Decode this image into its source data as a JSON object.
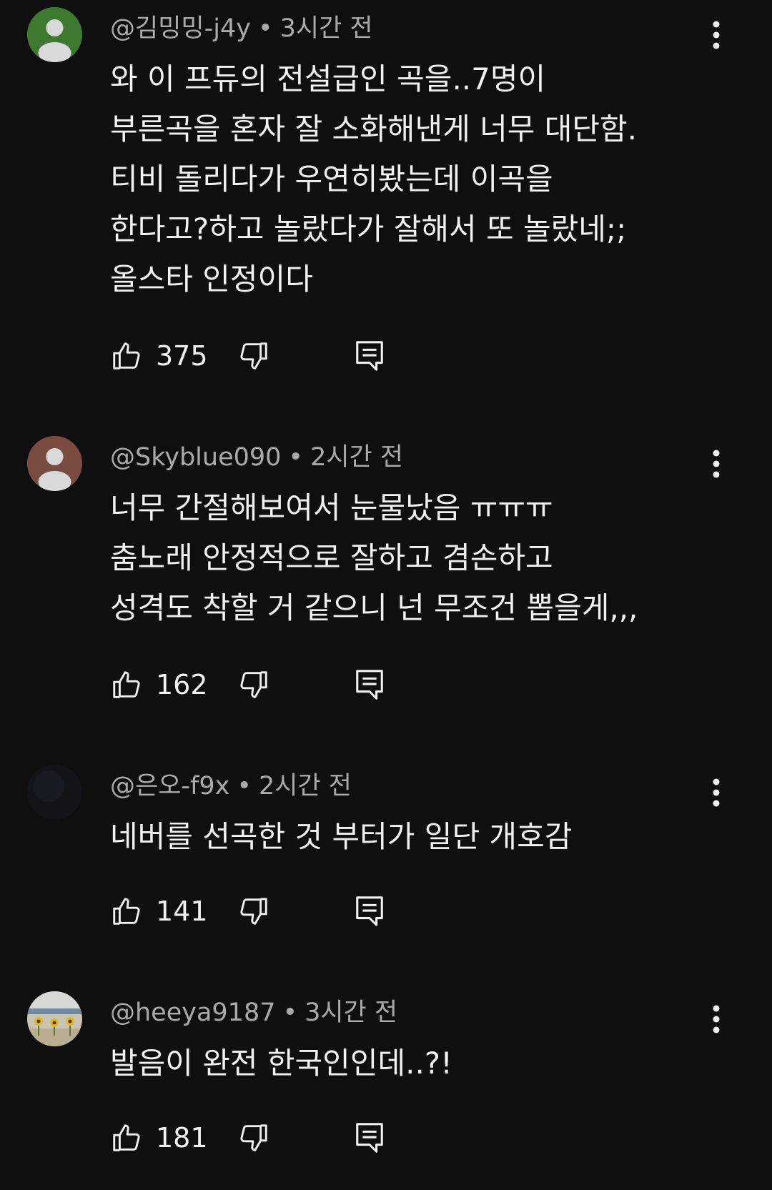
{
  "comments": [
    {
      "author": "@김밍밍-j4y",
      "time": "3시간 전",
      "avatar": "default-avatar-green",
      "avatar_color": "#3d7a2f",
      "lines": [
        "와 이 프듀의 전설급인 곡을..7명이",
        "부른곡을 혼자 잘 소화해낸게 너무 대단함.",
        "티비 돌리다가 우연히봤는데 이곡을",
        "한다고?하고 놀랐다가 잘해서 또 놀랐네;;",
        "올스타 인정이다"
      ],
      "likes": "375"
    },
    {
      "author": "@Skyblue090",
      "time": "2시간 전",
      "avatar": "default-avatar-brown",
      "avatar_color": "#7a4b40",
      "lines": [
        "너무 간절해보여서 눈물났음 ㅠㅠㅠ",
        "춤노래 안정적으로 잘하고 겸손하고",
        "성격도 착할 거 같으니 넌 무조건 뽑을게,,,"
      ],
      "likes": "162"
    },
    {
      "author": "@은오-f9x",
      "time": "2시간 전",
      "avatar": "dark-photo-avatar",
      "avatar_color": "#121418",
      "lines": [
        "네버를 선곡한 것 부터가 일단 개호감"
      ],
      "likes": "141"
    },
    {
      "author": "@heeya9187",
      "time": "3시간 전",
      "avatar": "sunflower-photo-avatar",
      "avatar_color": "#c9c4b4",
      "lines": [
        "발음이 완전 한국인인데..?!"
      ],
      "likes": "181"
    }
  ],
  "icons": {
    "like": "thumb-up-icon",
    "dislike": "thumb-down-icon",
    "reply": "reply-icon",
    "more": "more-vertical-icon"
  }
}
